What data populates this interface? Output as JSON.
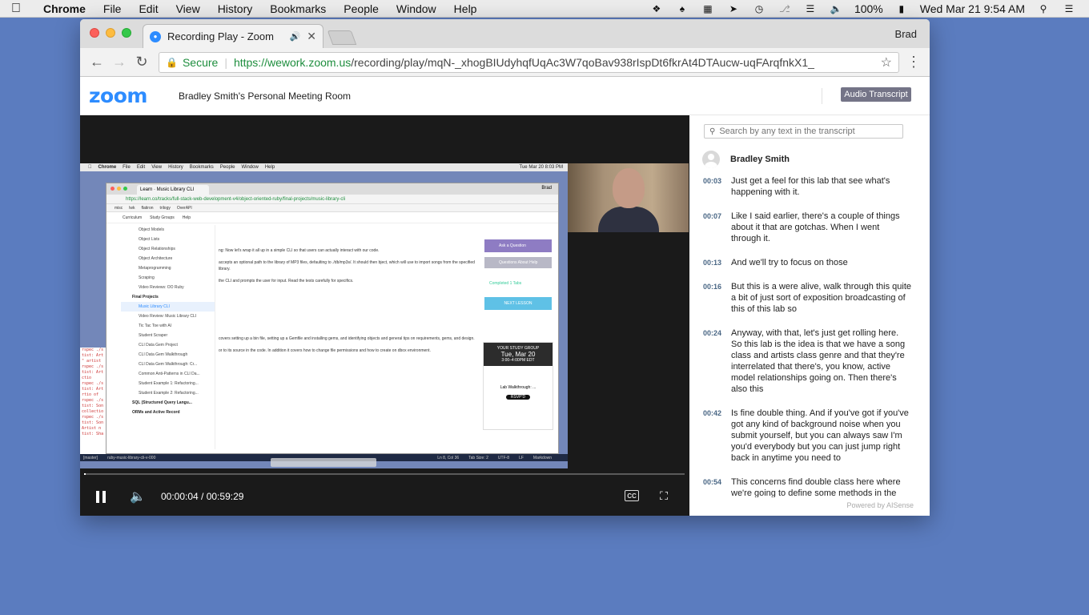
{
  "os_menubar": {
    "app": "Chrome",
    "items": [
      "File",
      "Edit",
      "View",
      "History",
      "Bookmarks",
      "People",
      "Window",
      "Help"
    ],
    "battery": "100%",
    "clock": "Wed Mar 21  9:54 AM"
  },
  "browser": {
    "tab_title": "Recording Play - Zoom",
    "profile": "Brad",
    "secure_label": "Secure",
    "url_host": "https://wework.zoom.us",
    "url_path": "/recording/play/mqN-_xhogBIUdyhqfUqAc3W7qoBav938rIspDt6fkrAt4DTAucw-uqFArqfnkX1_"
  },
  "zoom": {
    "logo": "zoom",
    "room_title": "Bradley Smith's Personal Meeting Room",
    "transcript_button": "Audio Transcript"
  },
  "screen_share": {
    "mini_menu": [
      "Chrome",
      "File",
      "Edit",
      "View",
      "History",
      "Bookmarks",
      "People",
      "Window",
      "Help"
    ],
    "mini_clock": "Tue Mar 20  8:03 PM",
    "tab_title": "Learn · Music Library CLI",
    "user": "Brad",
    "url": "https://learn.co/tracks/full-stack-web-development-v4/object-oriented-ruby/final-projects/music-library-cli",
    "bookmarks": [
      "misc",
      "lwk",
      "flatiron",
      "trilogy",
      "OverAPI"
    ],
    "nav": [
      "Curriculum",
      "Study Groups",
      "Help"
    ],
    "sidebar": [
      "Object Models",
      "Object Lists",
      "Object Relationships",
      "Object Architecture",
      "Metaprogramming",
      "Scraping",
      "Video Reviews: OO Ruby",
      "Final Projects",
      "Music Library CLI",
      "Video Review: Music Library CLI",
      "Tic Tac Toe with AI",
      "Student Scraper",
      "CLI Data Gem Project",
      "CLI Data Gem Walkthrough",
      "CLI Data Gem Walkthrough: Cr...",
      "Common Anti-Patterns in CLI Da...",
      "Student Example 1: Refactoring...",
      "Student Example 2: Refactoring...",
      "SQL (Structured Query Langu...",
      "ORMs and Active Record"
    ],
    "content": [
      "ng: Now let's wrap it all up in a simple CLI so that users can actually interact with our code.",
      "accepts an optional path to the library of MP3 files, defaulting to ./db/mp3s/. It should then bject, which will use to import songs from the specified library.",
      "the CLI and prompts the user for input. Read the tests carefully for specifics.",
      "covers setting up a bin file, setting up a Gemfile and installing gems, and identifying objects and general tips on requirements, gems, and design.",
      "or to its source in the code. In addition it covers how to change file permissions and how to create on dbox environment."
    ],
    "ask_question": "Ask a Question",
    "questions_about": "Questions About Help",
    "completed": "Completed 1 Tabs",
    "next_lesson": "NEXT LESSON",
    "study_group_label": "YOUR STUDY GROUP",
    "study_date": "Tue, Mar 20",
    "study_time": "3:00–4:00PM EDT",
    "study_title": "Lab Walkthrough: ...",
    "rsvp": "RSVP'D",
    "term_status": [
      "[master]",
      "ruby-music-library-cli-v-000",
      "Ln 8, Col 36",
      "Tab Size: 2",
      "UTF-8",
      "LF",
      "Markdown"
    ]
  },
  "player": {
    "time": "00:00:04 / 00:59:29",
    "progress": 0.001,
    "cc_label": "CC"
  },
  "transcript": {
    "search_placeholder": "Search by any text in the transcript",
    "speaker": "Bradley Smith",
    "entries": [
      {
        "t": "00:03",
        "text": "Just get a feel for this lab that see what's happening with it."
      },
      {
        "t": "00:07",
        "text": "Like I said earlier, there's a couple of things about it that are gotchas. When I went through it."
      },
      {
        "t": "00:13",
        "text": "And we'll try to focus on those"
      },
      {
        "t": "00:16",
        "text": "But this is a were alive, walk through this quite a bit of just sort of exposition broadcasting of this of this lab so"
      },
      {
        "t": "00:24",
        "text": "Anyway, with that, let's just get rolling here. So this lab is the idea is that we have a song class and artists class genre and that they're interrelated that there's, you know, active model relationships going on. Then there's also this"
      },
      {
        "t": "00:42",
        "text": "Is fine double thing. And if you've got if you've got any kind of background noise when you submit yourself, but you can always saw I'm you'd everybody but you can just jump right back in anytime you need to"
      },
      {
        "t": "00:54",
        "text": "This concerns find double class here where we're going to define some methods in the fine double class and bring them in, or extend them"
      }
    ],
    "powered_by": "Powered by AISense"
  }
}
